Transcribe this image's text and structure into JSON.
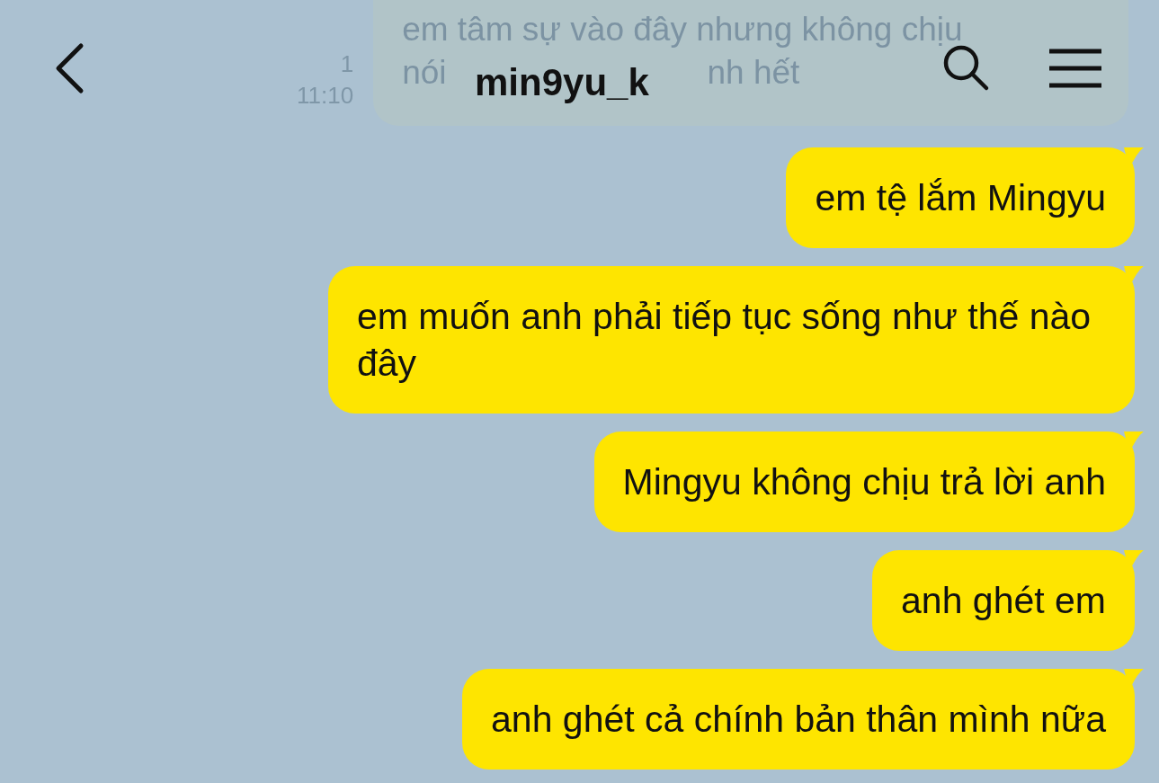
{
  "header": {
    "title": "min9yu_k",
    "faded_message": {
      "line_1": "em tâm sự vào đây nhưng không chịu",
      "line_2_start": "nói",
      "line_2_end": "nh hết",
      "unread": "1",
      "time": "11:10"
    }
  },
  "messages": [
    {
      "text": "em tệ lắm Mingyu"
    },
    {
      "text": "em muốn anh phải tiếp tục sống như thế nào đây"
    },
    {
      "text": "Mingyu không chịu trả lời anh"
    },
    {
      "text": "anh ghét em"
    },
    {
      "text": "anh ghét cả chính bản thân mình nữa"
    }
  ]
}
